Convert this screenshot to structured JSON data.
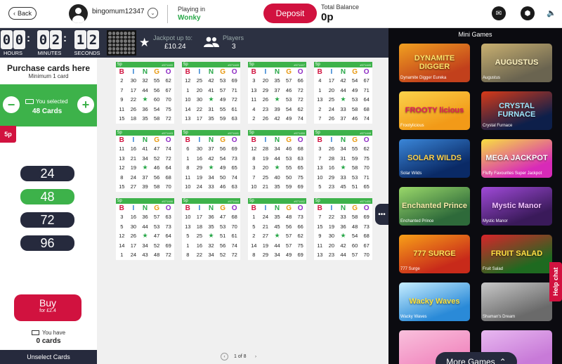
{
  "header": {
    "back_label": "Back",
    "username": "bingomum12347",
    "playing_in_label": "Playing in",
    "room_name": "Wonky",
    "deposit_label": "Deposit",
    "balance_label": "Total Balance",
    "balance_value": "0p"
  },
  "timer": {
    "hours": [
      "0",
      "0"
    ],
    "minutes": [
      "0",
      "2"
    ],
    "seconds": [
      "1",
      "2"
    ],
    "hours_label": "HOURS",
    "minutes_label": "MINUTES",
    "seconds_label": "SECONDS",
    "jackpot_label": "Jackpot up to:",
    "jackpot_value": "£10.24",
    "players_label": "Players",
    "players_value": "3"
  },
  "purchase": {
    "title": "Purchase cards here",
    "subtitle": "Minimum 1 card",
    "selected_line1": "You selected",
    "selected_line2": "48 Cards",
    "price_tag": "5p",
    "quantities": [
      "24",
      "48",
      "72",
      "96"
    ],
    "active_quantity": "48",
    "buy_label": "Buy",
    "buy_sub": "for £2.4",
    "you_have_label": "You have",
    "you_have_value": "0 cards",
    "unselect_label": "Unselect Cards"
  },
  "cards": {
    "letters": [
      "B",
      "I",
      "N",
      "G",
      "O"
    ],
    "letter_colors": [
      "#d1123f",
      "#2d7fd1",
      "#2aa84a",
      "#e89a12",
      "#8e2bc4"
    ],
    "price": "5p",
    "pager_text": "1 of 8",
    "items": [
      {
        "id": "#071440",
        "rows": [
          [
            "2",
            "30",
            "32",
            "55",
            "62"
          ],
          [
            "7",
            "17",
            "44",
            "56",
            "67"
          ],
          [
            "9",
            "22",
            "★",
            "60",
            "70"
          ],
          [
            "11",
            "26",
            "36",
            "54",
            "75"
          ],
          [
            "15",
            "18",
            "35",
            "58",
            "72"
          ]
        ]
      },
      {
        "id": "#071443",
        "rows": [
          [
            "11",
            "16",
            "41",
            "47",
            "74"
          ],
          [
            "13",
            "21",
            "34",
            "52",
            "72"
          ],
          [
            "12",
            "19",
            "★",
            "46",
            "64"
          ],
          [
            "8",
            "24",
            "37",
            "56",
            "68"
          ],
          [
            "15",
            "27",
            "39",
            "58",
            "70"
          ]
        ]
      },
      {
        "id": "#071446",
        "rows": [
          [
            "3",
            "16",
            "36",
            "57",
            "63"
          ],
          [
            "5",
            "30",
            "44",
            "53",
            "73"
          ],
          [
            "12",
            "26",
            "★",
            "47",
            "64"
          ],
          [
            "14",
            "17",
            "34",
            "52",
            "69"
          ],
          [
            "1",
            "24",
            "43",
            "48",
            "72"
          ]
        ]
      },
      {
        "id": "#071449",
        "rows": [
          [
            "12",
            "25",
            "42",
            "53",
            "69"
          ],
          [
            "1",
            "20",
            "41",
            "57",
            "71"
          ],
          [
            "10",
            "30",
            "★",
            "49",
            "72"
          ],
          [
            "14",
            "22",
            "31",
            "55",
            "61"
          ],
          [
            "13",
            "17",
            "35",
            "59",
            "63"
          ]
        ]
      },
      {
        "id": "#071441",
        "rows": [
          [
            "6",
            "30",
            "37",
            "56",
            "69"
          ],
          [
            "1",
            "16",
            "42",
            "54",
            "73"
          ],
          [
            "8",
            "29",
            "★",
            "49",
            "65"
          ],
          [
            "11",
            "19",
            "34",
            "50",
            "74"
          ],
          [
            "10",
            "24",
            "33",
            "46",
            "63"
          ]
        ]
      },
      {
        "id": "#071444",
        "rows": [
          [
            "10",
            "17",
            "36",
            "47",
            "68"
          ],
          [
            "13",
            "18",
            "35",
            "53",
            "70"
          ],
          [
            "5",
            "25",
            "★",
            "51",
            "61"
          ],
          [
            "1",
            "16",
            "32",
            "56",
            "74"
          ],
          [
            "8",
            "22",
            "34",
            "52",
            "72"
          ]
        ]
      },
      {
        "id": "#071447",
        "rows": [
          [
            "3",
            "20",
            "35",
            "57",
            "66"
          ],
          [
            "13",
            "29",
            "37",
            "46",
            "72"
          ],
          [
            "11",
            "26",
            "★",
            "53",
            "72"
          ],
          [
            "4",
            "23",
            "39",
            "54",
            "62"
          ],
          [
            "2",
            "26",
            "42",
            "49",
            "74"
          ]
        ]
      },
      {
        "id": "#071450",
        "rows": [
          [
            "12",
            "28",
            "34",
            "46",
            "68"
          ],
          [
            "8",
            "19",
            "44",
            "53",
            "63"
          ],
          [
            "3",
            "20",
            "★",
            "55",
            "65"
          ],
          [
            "7",
            "25",
            "40",
            "50",
            "75"
          ],
          [
            "10",
            "21",
            "35",
            "59",
            "69"
          ]
        ]
      },
      {
        "id": "#071442",
        "rows": [
          [
            "1",
            "24",
            "35",
            "48",
            "73"
          ],
          [
            "5",
            "21",
            "45",
            "56",
            "66"
          ],
          [
            "2",
            "27",
            "★",
            "57",
            "62"
          ],
          [
            "14",
            "19",
            "44",
            "57",
            "75"
          ],
          [
            "8",
            "29",
            "34",
            "49",
            "69"
          ]
        ]
      },
      {
        "id": "#071445",
        "rows": [
          [
            "4",
            "17",
            "42",
            "54",
            "67"
          ],
          [
            "1",
            "20",
            "44",
            "49",
            "71"
          ],
          [
            "13",
            "25",
            "★",
            "53",
            "64"
          ],
          [
            "2",
            "24",
            "33",
            "58",
            "68"
          ],
          [
            "7",
            "26",
            "37",
            "46",
            "74"
          ]
        ]
      },
      {
        "id": "#071448",
        "rows": [
          [
            "3",
            "26",
            "34",
            "55",
            "62"
          ],
          [
            "7",
            "28",
            "31",
            "59",
            "75"
          ],
          [
            "13",
            "16",
            "★",
            "58",
            "70"
          ],
          [
            "10",
            "29",
            "33",
            "53",
            "71"
          ],
          [
            "5",
            "23",
            "45",
            "51",
            "65"
          ]
        ]
      },
      {
        "id": "#071451",
        "rows": [
          [
            "7",
            "22",
            "33",
            "58",
            "69"
          ],
          [
            "15",
            "19",
            "36",
            "48",
            "73"
          ],
          [
            "9",
            "30",
            "★",
            "54",
            "68"
          ],
          [
            "11",
            "20",
            "42",
            "60",
            "67"
          ],
          [
            "13",
            "23",
            "44",
            "57",
            "70"
          ]
        ]
      }
    ]
  },
  "minigames": {
    "title": "Mini Games",
    "more_label": "More Games",
    "help_label": "Help chat",
    "items": [
      {
        "name": "Dynamite Digger Eureka",
        "art": "DYNAMITE DIGGER",
        "bg": "#c2401c",
        "bg2": "#f0a020",
        "fg": "#fde26a"
      },
      {
        "name": "Augustus",
        "art": "AUGUSTUS",
        "bg": "#6a6450",
        "bg2": "#c9b070",
        "fg": "#fff3c0"
      },
      {
        "name": "Frootylicious",
        "art": "FROOTY licious",
        "bg": "#f29a18",
        "bg2": "#fbd24a",
        "fg": "#e01a5a"
      },
      {
        "name": "Crystal Furnace",
        "art": "CRYSTAL FURNACE",
        "bg": "#0d1f4a",
        "bg2": "#d83a18",
        "fg": "#9fe8ff"
      },
      {
        "name": "Solar Wilds",
        "art": "SOLAR WILDS",
        "bg": "#0a2a66",
        "bg2": "#3a86d8",
        "fg": "#ffd24a"
      },
      {
        "name": "Fluffy Favourites Super Jackpot",
        "art": "MEGA JACKPOT",
        "bg": "#d82ab8",
        "bg2": "#f8e040",
        "fg": "#ffffff"
      },
      {
        "name": "Enchanted Prince",
        "art": "Enchanted Prince",
        "bg": "#2e6a3a",
        "bg2": "#9ad86a",
        "fg": "#f4e9a8"
      },
      {
        "name": "Mystic Manor",
        "art": "Mystic Manor",
        "bg": "#3a1a5a",
        "bg2": "#a04ad8",
        "fg": "#f3c2ff"
      },
      {
        "name": "777 Surge",
        "art": "777 SURGE",
        "bg": "#c82a1a",
        "bg2": "#f8a018",
        "fg": "#ffe15a"
      },
      {
        "name": "Fruit Salad",
        "art": "FRUIT SALAD",
        "bg": "#1e6a20",
        "bg2": "#d8242a",
        "fg": "#ffe044"
      },
      {
        "name": "Wacky Waves",
        "art": "Wacky Waves",
        "bg": "#2a8ad8",
        "bg2": "#c7eeff",
        "fg": "#ffe23a"
      },
      {
        "name": "Shaman's Dream",
        "art": "",
        "bg": "#6a6a6a",
        "bg2": "#c8c8c8",
        "fg": "#ffffff"
      },
      {
        "name": "",
        "art": "",
        "bg": "#f18ac0",
        "bg2": "#f9c0dc",
        "fg": "#ffffff"
      },
      {
        "name": "",
        "art": "",
        "bg": "#c87ad8",
        "bg2": "#e8b8f0",
        "fg": "#ffffff"
      }
    ]
  }
}
